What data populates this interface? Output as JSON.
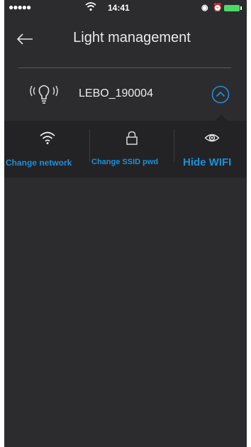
{
  "statusbar": {
    "signal": "●●●●●",
    "time": "14:41",
    "lock_glyph": "◉",
    "alarm_glyph": "⏰"
  },
  "header": {
    "back_icon": "back-arrow-icon",
    "title": "Light management"
  },
  "device": {
    "icon": "bulb-icon",
    "name": "LEBO_190004",
    "toggle_icon": "chevron-up-circle-icon"
  },
  "actions": [
    {
      "icon": "wifi-icon",
      "label": "Change network"
    },
    {
      "icon": "lock-icon",
      "label": "Change SSID pwd"
    },
    {
      "icon": "eye-icon",
      "label": "Hide WIFI"
    }
  ],
  "colors": {
    "background": "#2c2c2e",
    "panel": "#232325",
    "accent": "#1e8fd9",
    "battery": "#4cd964"
  }
}
